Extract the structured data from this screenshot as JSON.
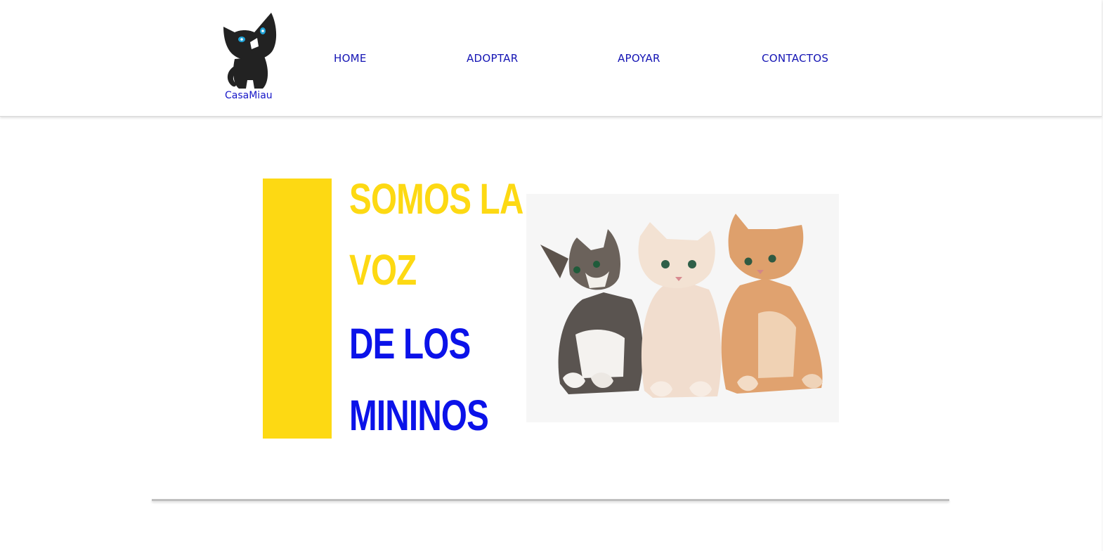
{
  "brand": {
    "name": "CasaMiau",
    "logo_icon": "black-cat-icon"
  },
  "nav": {
    "items": [
      {
        "label": "HOME"
      },
      {
        "label": "ADOPTAR"
      },
      {
        "label": "APOYAR"
      },
      {
        "label": "CONTACTOS"
      }
    ]
  },
  "hero": {
    "lines": [
      "SOMOS LA",
      "VOZ",
      "DE LOS",
      "MININOS"
    ],
    "image": "three-kittens-photo"
  },
  "colors": {
    "accent_yellow": "#fdd913",
    "accent_blue": "#0b12e9",
    "nav_text": "#1414b4"
  }
}
